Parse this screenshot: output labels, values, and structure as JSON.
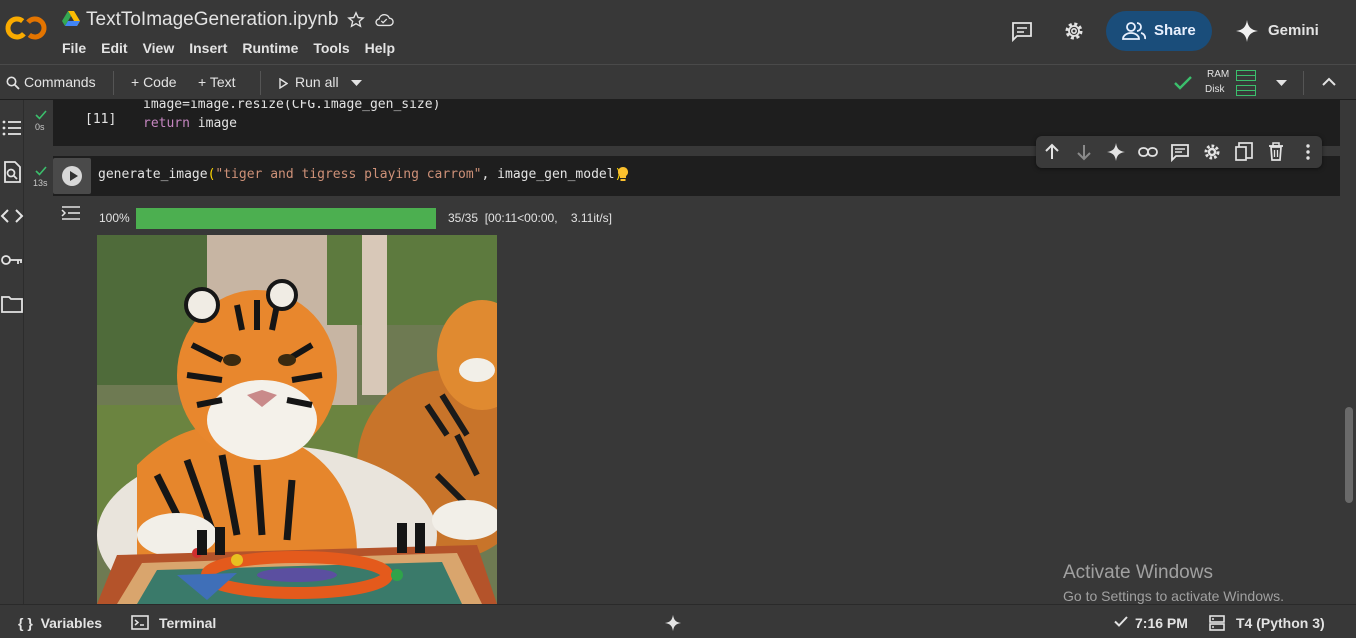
{
  "header": {
    "logo": "CO",
    "file_title": "TextToImageGeneration.ipynb",
    "menu": [
      "File",
      "Edit",
      "View",
      "Insert",
      "Runtime",
      "Tools",
      "Help"
    ],
    "share_label": "Share",
    "gemini_label": "Gemini"
  },
  "toolbar": {
    "commands_label": "Commands",
    "code_label": "+ Code",
    "text_label": "+ Text",
    "run_all_label": "Run all",
    "ram_label": "RAM",
    "disk_label": "Disk"
  },
  "cell1": {
    "status": "0s",
    "count": "[11]",
    "line1": "image=image.resize(CFG.image_gen_size)",
    "line2_keyword": "return",
    "line2_rest": " image"
  },
  "cell2": {
    "status": "13s",
    "fn": "generate_image",
    "open_paren": "(",
    "arg_string": "\"tiger and tigress playing carrom\"",
    "arg_rest": ", image_gen_model",
    "close_paren": ")"
  },
  "output": {
    "progress_percent_label": "100%",
    "progress_fraction": 1.0,
    "progress_text": "35/35  [00:11<00:00,    3.11it/s]"
  },
  "watermark": {
    "title": "Activate Windows",
    "subtitle": "Go to Settings to activate Windows."
  },
  "statusbar": {
    "variables_label": "Variables",
    "terminal_label": "Terminal",
    "time": "7:16 PM",
    "runtime": "T4 (Python 3)"
  },
  "colors": {
    "accent_green": "#4caf50",
    "share_bg": "#1a4d7a",
    "logo_orange": "#f9ab00"
  }
}
